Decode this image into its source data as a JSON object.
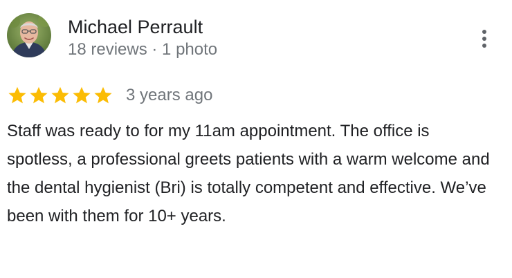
{
  "reviewer": {
    "name": "Michael Perrault",
    "reviews_count": "18 reviews",
    "separator": " · ",
    "photos_count": "1 photo"
  },
  "review": {
    "rating": 5,
    "rating_max": 5,
    "date": "3 years ago",
    "text": "Staff was ready to for my 11am appointment. The office is spotless, a professional greets patients with a warm welcome and the dental hygienist (Bri) is totally competent and effective. We’ve been with them for 10+ years."
  },
  "icons": {
    "more": "more-vert-icon",
    "star": "star-icon",
    "avatar": "profile-photo"
  },
  "colors": {
    "star": "#fbbc04",
    "text_primary": "#202124",
    "text_secondary": "#70757a"
  }
}
